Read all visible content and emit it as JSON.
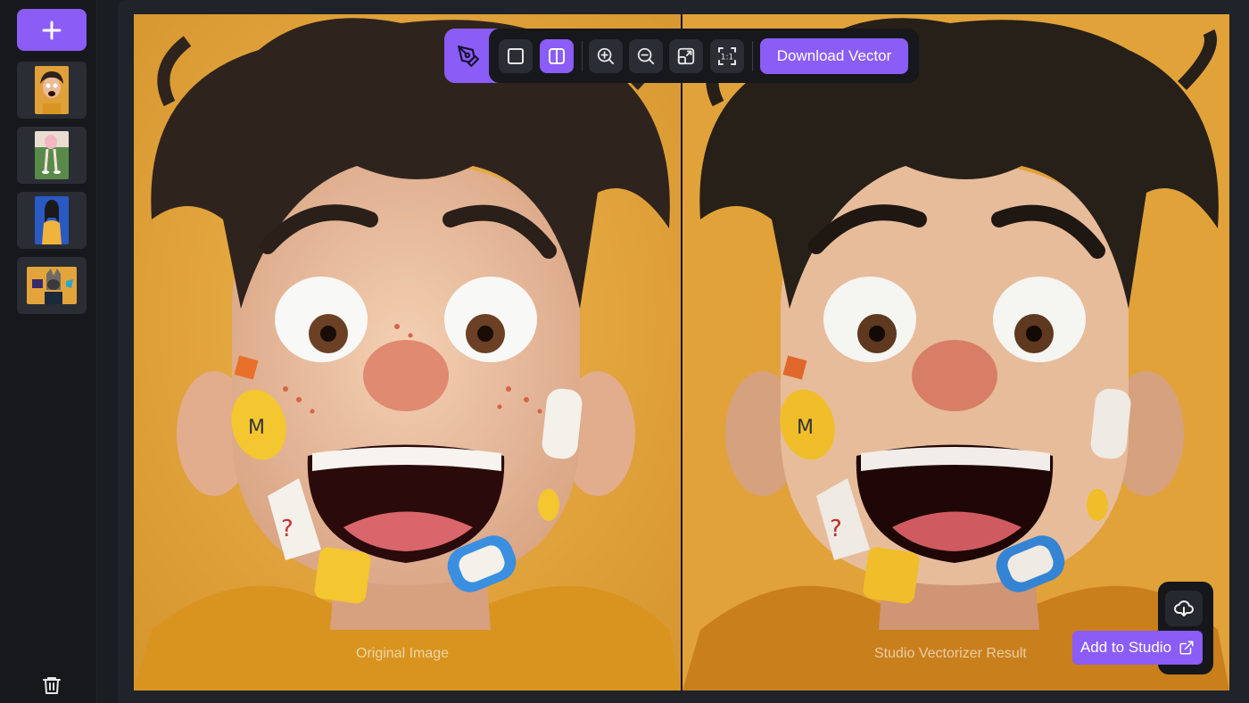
{
  "sidebar": {
    "add_label": "+",
    "thumbnails": [
      {
        "name": "boy-portrait"
      },
      {
        "name": "badminton-player"
      },
      {
        "name": "woman-blue-background"
      },
      {
        "name": "character-thumbnail"
      }
    ]
  },
  "toolbar": {
    "download_label": "Download Vector",
    "zoom_reset_label": "1:1"
  },
  "compare": {
    "left_caption": "Original Image",
    "right_caption": "Studio Vectorizer Result"
  },
  "actions": {
    "add_to_studio_label": "Add to Studio"
  },
  "colors": {
    "accent": "#8b5cf6",
    "background": "#e3a63d"
  }
}
